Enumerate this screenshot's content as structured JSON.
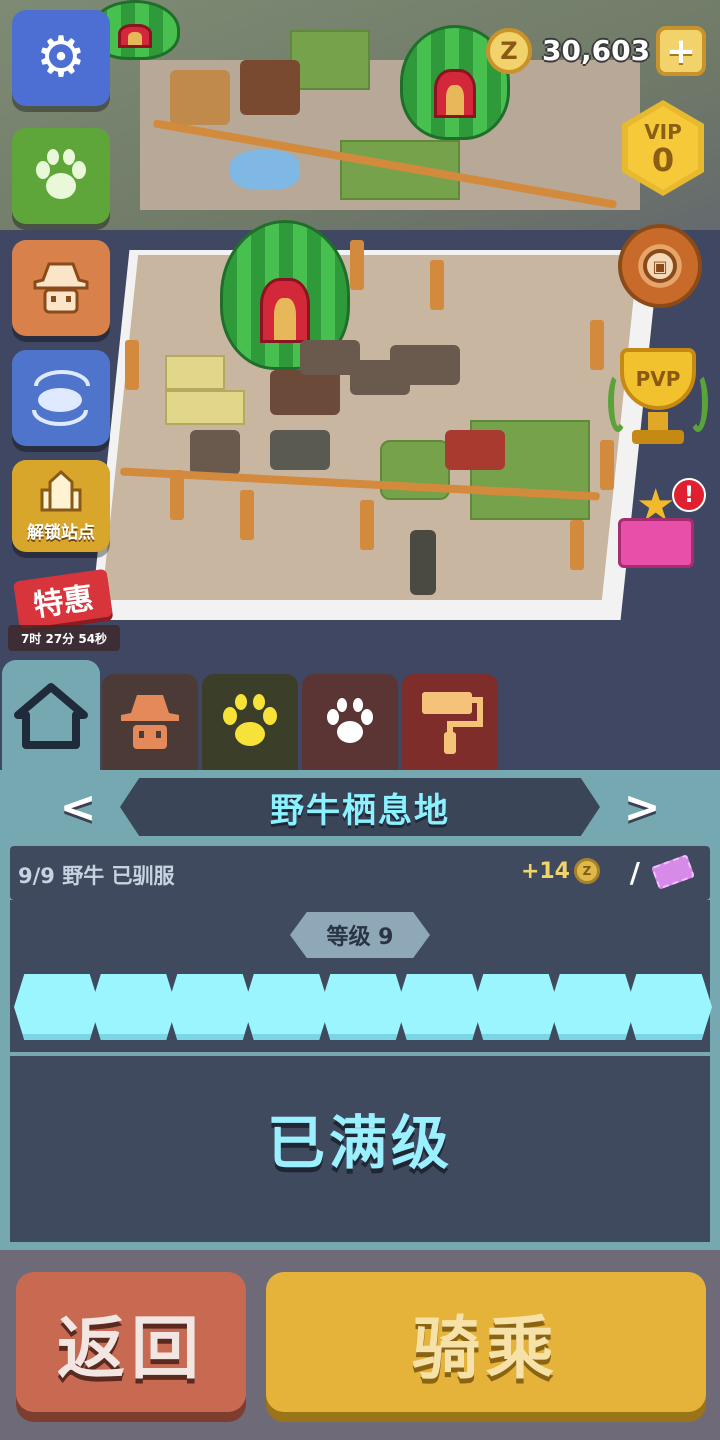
{
  "hud": {
    "coins": "30,603",
    "coin_symbol": "Z",
    "add_symbol": "+",
    "vip_title": "VIP",
    "vip_level": "0",
    "pvp_label": "PVP",
    "gift_badge": "!"
  },
  "left_menu": {
    "unlock_stations_label": "解锁站点",
    "sale_label": "特惠",
    "sale_timer": "7时 27分 54秒"
  },
  "tabs": [
    "home-icon",
    "zookeeper-icon",
    "paw-icon",
    "paw-icon",
    "paint-roller-icon"
  ],
  "habitat": {
    "prev_arrow": "<",
    "next_arrow": ">",
    "title": "野牛栖息地",
    "tamed_status": "9/9 野牛 已驯服",
    "reward": "+14",
    "reward_coin_symbol": "Z",
    "separator": "/",
    "level_label": "等级 9",
    "level_segments_filled": 9,
    "level_segments_total": 9,
    "max_level_text": "已满级"
  },
  "footer": {
    "back_label": "返回",
    "ride_label": "骑乘"
  },
  "colors": {
    "panel": "#76a8b2",
    "bar_fill": "#9bf5ff",
    "back_button": "#c86a52",
    "ride_button": "#e6b33a"
  }
}
